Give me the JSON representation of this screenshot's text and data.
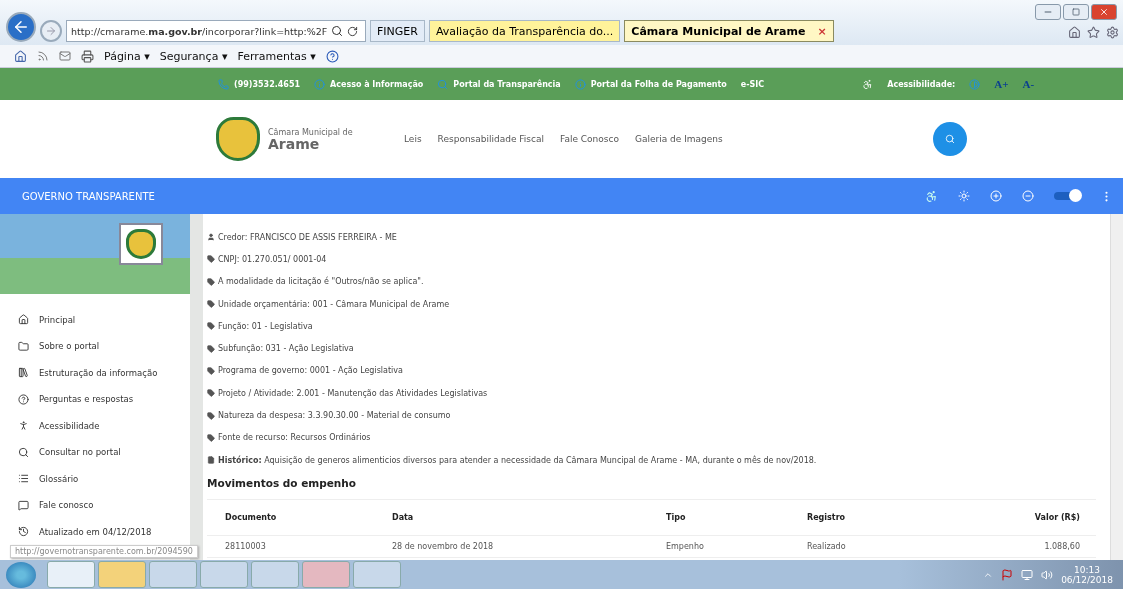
{
  "browser": {
    "address": "http://cmarame.**ma.gov.br**/incorporar?link=http:%2F",
    "tabs": [
      {
        "label": "FINGER",
        "selected": false,
        "color": "#e3ecf7"
      },
      {
        "label": "Avaliação da Transparência do...",
        "selected": false,
        "color": "#fff39a"
      },
      {
        "label": "Câmara Municipal de Arame",
        "selected": true,
        "color": "#fff7c4"
      }
    ],
    "close_tab": "×",
    "commands": [
      "Página ▾",
      "Segurança ▾",
      "Ferramentas ▾"
    ]
  },
  "topbar": {
    "items": [
      {
        "kind": "phone",
        "label": "(99)3532.4651"
      },
      {
        "kind": "info",
        "label": "Acesso à Informação"
      },
      {
        "kind": "search",
        "label": "Portal da Transparência"
      },
      {
        "kind": "info",
        "label": "Portal da Folha de Pagamento"
      },
      {
        "kind": "plain",
        "label": "e-SIC"
      }
    ],
    "accessibility": "Acessibilidade:",
    "font_up": "A+",
    "font_down": "A-"
  },
  "header": {
    "subtitle": "Câmara Municipal de",
    "title": "Arame",
    "nav": [
      "Leis",
      "Responsabilidade Fiscal",
      "Fale Conosco",
      "Galeria de Imagens"
    ]
  },
  "portal_bar": {
    "title": "GOVERNO TRANSPARENTE",
    "toggle_on": true
  },
  "sidebar": {
    "items": [
      {
        "kind": "home",
        "label": "Principal"
      },
      {
        "kind": "folder",
        "label": "Sobre o portal"
      },
      {
        "kind": "library",
        "label": "Estruturação da informação"
      },
      {
        "kind": "help",
        "label": "Perguntas e respostas"
      },
      {
        "kind": "person",
        "label": "Acessibilidade"
      },
      {
        "kind": "search",
        "label": "Consultar no portal"
      },
      {
        "kind": "list",
        "label": "Glossário"
      },
      {
        "kind": "chat",
        "label": "Fale conosco"
      },
      {
        "kind": "history",
        "label": "Atualizado em 04/12/2018"
      }
    ]
  },
  "details": [
    {
      "kind": "user",
      "text": "Credor: FRANCISCO DE ASSIS FERREIRA - ME"
    },
    {
      "kind": "tag",
      "text": "CNPJ: 01.270.051/ 0001-04"
    },
    {
      "kind": "tag",
      "text": "A modalidade da licitação é \"Outros/não se aplica\"."
    },
    {
      "kind": "tag",
      "text": "Unidade orçamentária: 001 - Câmara Municipal de Arame"
    },
    {
      "kind": "tag",
      "text": "Função: 01 - Legislativa"
    },
    {
      "kind": "tag",
      "text": "Subfunção: 031 - Ação Legislativa"
    },
    {
      "kind": "tag",
      "text": "Programa de governo: 0001 - Ação Legislativa"
    },
    {
      "kind": "tag",
      "text": "Projeto / Atividade: 2.001 - Manutenção das Atividades Legislativas"
    },
    {
      "kind": "tag",
      "text": "Natureza da despesa: 3.3.90.30.00 - Material de consumo"
    },
    {
      "kind": "tag",
      "text": "Fonte de recurso: Recursos Ordinários"
    },
    {
      "kind": "doc",
      "text": "**Histórico:** Aquisição de generos alimenticios diversos para atender a necessidade da Câmara Muncipal de Arame - MA, durante o mês de nov/2018."
    }
  ],
  "movements": {
    "title": "Movimentos do empenho",
    "columns": [
      "Documento",
      "Data",
      "Tipo",
      "Registro",
      "Valor (R$)"
    ],
    "rows": [
      [
        "28110003",
        "28 de novembro de 2018",
        "Empenho",
        "Realizado",
        "1.088,60"
      ]
    ]
  },
  "status_url": "http://governotransparente.com.br/2094590",
  "taskbar": {
    "time": "10:13",
    "date": "06/12/2018"
  }
}
